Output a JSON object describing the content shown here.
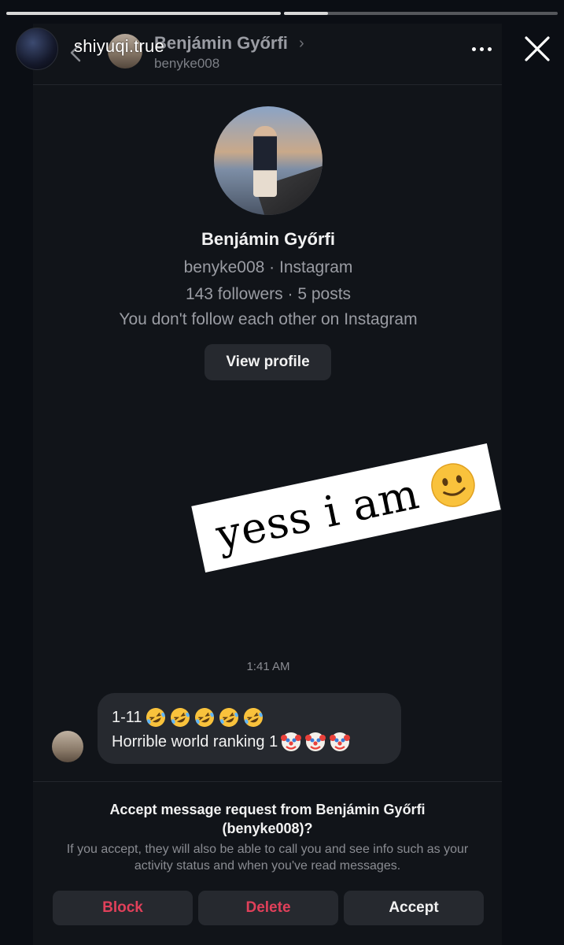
{
  "story": {
    "username": "shiyuqi.true",
    "progress": [
      1.0,
      0.16
    ]
  },
  "chat_header": {
    "name": "Benjámin Győrfi",
    "username": "benyke008"
  },
  "profile": {
    "name": "Benjámin Győrfi",
    "line1": "benyke008 · Instagram",
    "line2": "143 followers · 5 posts",
    "line3": "You don't follow each other on Instagram",
    "view_profile_label": "View profile"
  },
  "sticker": {
    "text": "yess i am"
  },
  "conversation": {
    "timestamp": "1:41 AM",
    "message_line1": "1-11",
    "message_line2": "Horrible world ranking 1"
  },
  "request": {
    "title_line1": "Accept message request from Benjámin Győrfi",
    "title_line2": "(benyke008)?",
    "description": "If you accept, they will also be able to call you and see info such as your activity status and when you've read messages.",
    "block_label": "Block",
    "delete_label": "Delete",
    "accept_label": "Accept"
  },
  "colors": {
    "background": "#0b0e14",
    "panel": "#111419",
    "button": "#26292f",
    "destructive": "#e0405a"
  }
}
